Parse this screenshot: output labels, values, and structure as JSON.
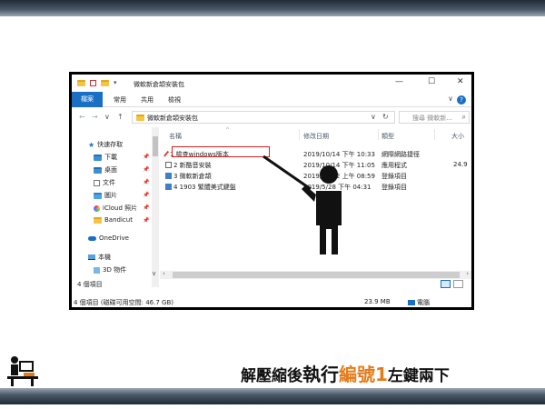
{
  "window": {
    "title": "微軟新倉頡安裝包",
    "controls": {
      "minimize": "—",
      "maximize": "☐",
      "close": "✕"
    }
  },
  "ribbon": {
    "tabs": [
      "檔案",
      "常用",
      "共用",
      "檢視"
    ],
    "chevron": "∨",
    "help": "?"
  },
  "address": {
    "back": "←",
    "forward": "→",
    "recent": "∨",
    "up": "↑",
    "path": "微軟新倉頡安裝包",
    "refresh_dropdown": "∨",
    "refresh": "↻",
    "search_placeholder": "搜尋 微軟新..."
  },
  "sidebar": {
    "quick_access": "快速存取",
    "items": [
      "下載",
      "桌面",
      "文件",
      "圖片",
      "iCloud 照片",
      "Bandicut"
    ],
    "onedrive": "OneDrive",
    "this_pc": "本機",
    "objects3d": "3D 物件"
  },
  "columns": {
    "name": "名稱",
    "modified": "修改日期",
    "type": "類型",
    "size": "大小"
  },
  "files": [
    {
      "name": "1 檢查windows版本",
      "modified": "2019/10/14 下午 10:33",
      "type": "網際網路捷徑",
      "size": ""
    },
    {
      "name": "2 新酷音安裝",
      "modified": "2019/10/14 下午 11:05",
      "type": "應用程式",
      "size": "24.9"
    },
    {
      "name": "3 微軟新倉頡",
      "modified": "2019/10/12 上午 08:59",
      "type": "登錄項目",
      "size": ""
    },
    {
      "name": "4 1903 繁體美式鍵盤",
      "modified": "2019/5/28 下午 04:31",
      "type": "登錄項目",
      "size": ""
    }
  ],
  "status": {
    "count": "4 個項目",
    "drive": "4 個項目 (磁碟可用空間: 46.7 GB)",
    "size": "23.9 MB",
    "computer": "電腦"
  },
  "caption": {
    "part1": "解壓縮後",
    "part2": "執行",
    "part3": "編號1",
    "part4": "左鍵兩下"
  },
  "colors": {
    "accent": "#1a6fc4",
    "highlight_box": "#d32020",
    "caption_orange": "#e37b1a"
  }
}
